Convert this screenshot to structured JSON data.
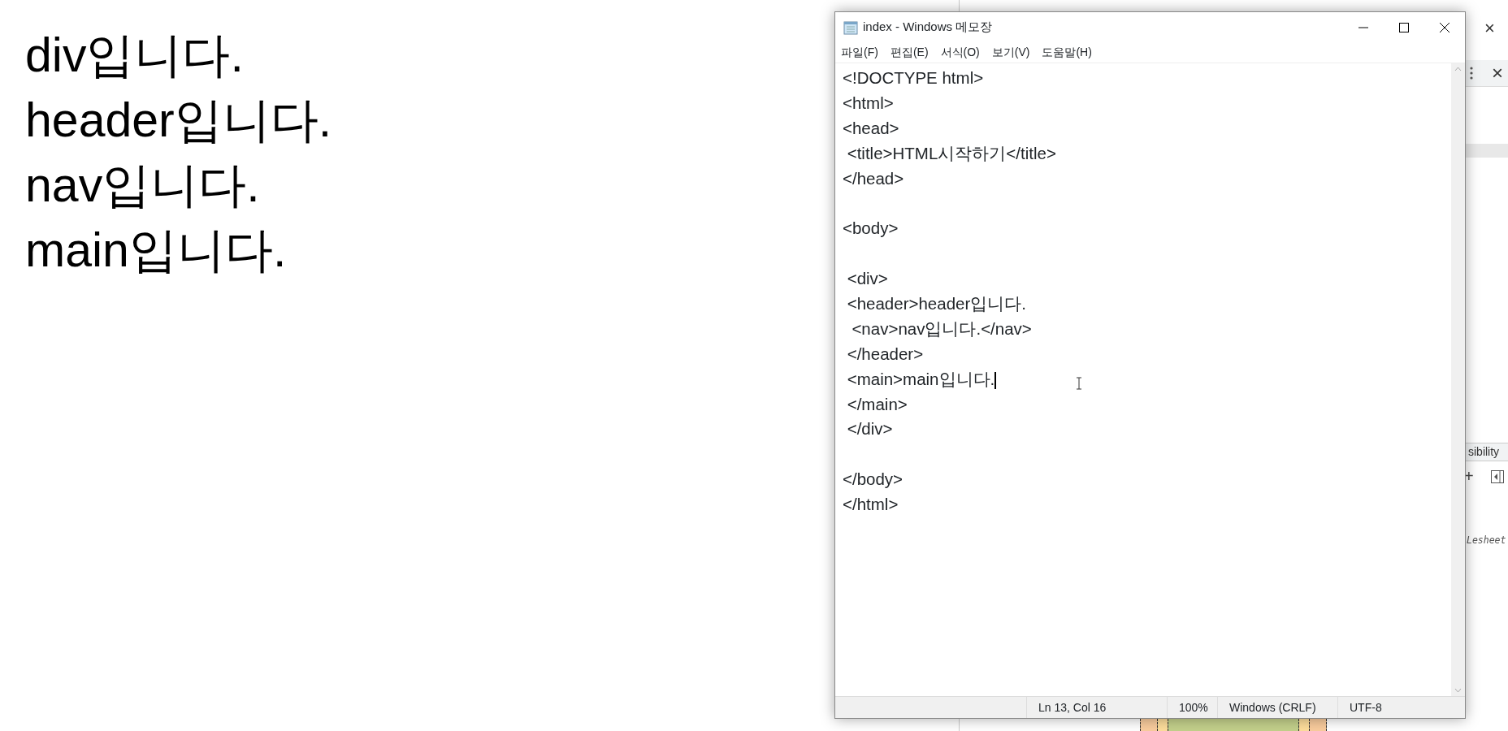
{
  "page_text": [
    "div입니다.",
    "header입니다.",
    "nav입니다.",
    "main입니다."
  ],
  "notepad": {
    "title": "index - Windows 메모장",
    "menu": [
      "파일(F)",
      "편집(E)",
      "서식(O)",
      "보기(V)",
      "도움말(H)"
    ],
    "lines": [
      {
        "kind": "code",
        "text": "<!DOCTYPE html>"
      },
      {
        "kind": "code",
        "text": "<html>"
      },
      {
        "kind": "code",
        "text": "<head>"
      },
      {
        "kind": "code",
        "text": " <title>HTML시작하기</title>"
      },
      {
        "kind": "code",
        "text": "</head>"
      },
      {
        "kind": "blank"
      },
      {
        "kind": "code",
        "text": "<body>"
      },
      {
        "kind": "blank"
      },
      {
        "kind": "code",
        "text": " <div>"
      },
      {
        "kind": "code",
        "text": " <header>header입니다."
      },
      {
        "kind": "code",
        "text": "  <nav>nav입니다.</nav>"
      },
      {
        "kind": "code",
        "text": " </header>"
      },
      {
        "kind": "code",
        "text": " <main>main입니다.",
        "caret": true
      },
      {
        "kind": "code",
        "text": " </main>"
      },
      {
        "kind": "code",
        "text": " </div>"
      },
      {
        "kind": "blank"
      },
      {
        "kind": "code",
        "text": "</body>"
      },
      {
        "kind": "code",
        "text": "</html>"
      }
    ],
    "status": [
      "Ln 13, Col 16",
      "100%",
      "Windows (CRLF)",
      "UTF-8"
    ]
  },
  "devtools": {
    "window_close": "×",
    "panel_close": "×",
    "tab_label": "sibility",
    "plus": "+",
    "stylesheet_text": "Lesheet"
  }
}
